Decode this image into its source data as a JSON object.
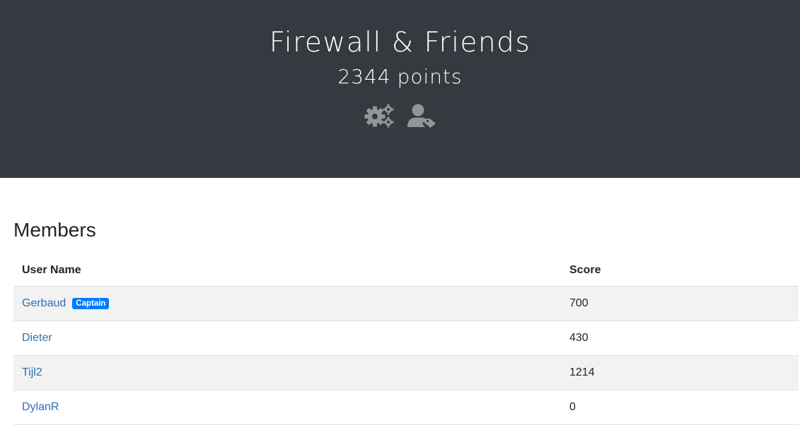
{
  "team": {
    "name": "Firewall & Friends",
    "points_value": "2344",
    "points_unit": "points",
    "settings_icon": "cogs-icon",
    "members_icon": "user-tag-icon"
  },
  "members": {
    "title": "Members",
    "columns": {
      "username": "User Name",
      "score": "Score"
    },
    "rows": [
      {
        "name": "Gerbaud",
        "badge": "Captain",
        "score": "700"
      },
      {
        "name": "Dieter",
        "badge": "",
        "score": "430"
      },
      {
        "name": "Tijl2",
        "badge": "",
        "score": "1214"
      },
      {
        "name": "DylanR",
        "badge": "",
        "score": "0"
      }
    ]
  },
  "colors": {
    "header_bg": "#343a40",
    "icon": "#939597",
    "link": "#2f6fb0",
    "badge": "#007bff",
    "stripe": "#f2f2f2"
  }
}
